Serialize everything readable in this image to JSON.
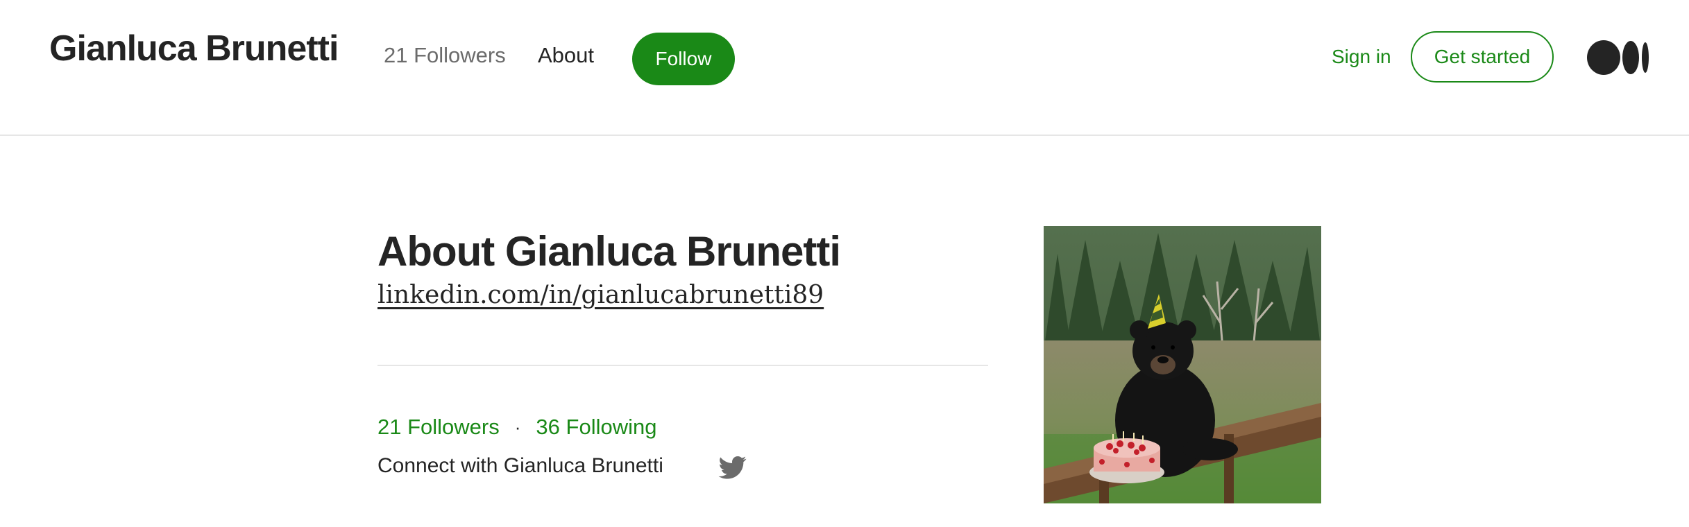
{
  "header": {
    "brand": "Gianluca Brunetti",
    "followers_link": "21 Followers",
    "about_link": "About",
    "follow_label": "Follow",
    "signin_label": "Sign in",
    "get_started_label": "Get started",
    "logo_icon": "medium-logo-icon"
  },
  "about": {
    "title": "About Gianluca Brunetti",
    "link_text": "linkedin.com/in/gianlucabrunetti89",
    "followers": "21 Followers",
    "separator": "·",
    "following": "36 Following",
    "connect_text": "Connect with Gianluca Brunetti",
    "twitter_icon": "twitter-bird-icon"
  },
  "image": {
    "subject": "bear-with-party-hat-and-cake-photo"
  },
  "colors": {
    "accent": "#1a8917",
    "text": "#242424",
    "muted": "#6b6b6b",
    "divider": "#e6e6e6"
  }
}
